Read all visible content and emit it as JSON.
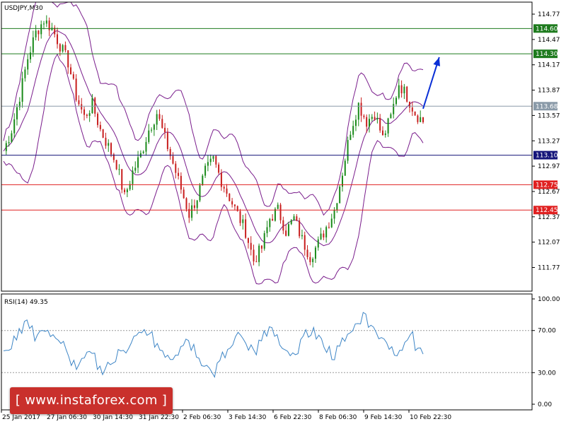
{
  "chart_data": {
    "type": "line",
    "symbol_label": "USDJPY,M30",
    "price_panel": {
      "y_ticks": [
        "114.77",
        "114.47",
        "114.17",
        "113.87",
        "113.57",
        "113.27",
        "112.97",
        "112.67",
        "112.37",
        "112.07",
        "111.77"
      ],
      "ylim": [
        111.6,
        114.93
      ],
      "levels": [
        {
          "value": 114.6,
          "label": "114.60",
          "color": "#1e7b1e"
        },
        {
          "value": 114.3,
          "label": "114.30",
          "color": "#1e7b1e"
        },
        {
          "value": 113.68,
          "label": "113.68",
          "color": "#8a9aa8"
        },
        {
          "value": 113.1,
          "label": "113.10",
          "color": "#15157a"
        },
        {
          "value": 112.75,
          "label": "112.75",
          "color": "#e02020"
        },
        {
          "value": 112.45,
          "label": "112.45",
          "color": "#e02020"
        }
      ],
      "close_path": [
        [
          0,
          113.15
        ],
        [
          3,
          113.4
        ],
        [
          6,
          113.8
        ],
        [
          9,
          114.25
        ],
        [
          12,
          114.55
        ],
        [
          15,
          114.7
        ],
        [
          18,
          114.6
        ],
        [
          21,
          114.4
        ],
        [
          24,
          114.2
        ],
        [
          27,
          113.8
        ],
        [
          30,
          113.55
        ],
        [
          33,
          113.7
        ],
        [
          36,
          113.4
        ],
        [
          39,
          113.2
        ],
        [
          42,
          113.0
        ],
        [
          45,
          112.6
        ],
        [
          48,
          112.9
        ],
        [
          51,
          113.1
        ],
        [
          54,
          113.4
        ],
        [
          57,
          113.6
        ],
        [
          60,
          113.3
        ],
        [
          63,
          113.0
        ],
        [
          66,
          112.7
        ],
        [
          69,
          112.4
        ],
        [
          72,
          112.6
        ],
        [
          75,
          112.9
        ],
        [
          78,
          113.05
        ],
        [
          81,
          112.8
        ],
        [
          84,
          112.6
        ],
        [
          87,
          112.4
        ],
        [
          90,
          112.2
        ],
        [
          93,
          111.85
        ],
        [
          96,
          112.0
        ],
        [
          99,
          112.35
        ],
        [
          102,
          112.45
        ],
        [
          105,
          112.2
        ],
        [
          108,
          112.35
        ],
        [
          111,
          112.1
        ],
        [
          114,
          111.9
        ],
        [
          117,
          112.05
        ],
        [
          120,
          112.25
        ],
        [
          123,
          112.45
        ],
        [
          126,
          112.9
        ],
        [
          129,
          113.4
        ],
        [
          132,
          113.7
        ],
        [
          135,
          113.5
        ],
        [
          138,
          113.6
        ],
        [
          141,
          113.3
        ],
        [
          144,
          113.55
        ],
        [
          147,
          113.95
        ],
        [
          150,
          113.8
        ],
        [
          153,
          113.6
        ],
        [
          156,
          113.5
        ]
      ],
      "arrow": {
        "from": [
          156,
          113.65
        ],
        "to": [
          162,
          114.26
        ]
      },
      "bands_description_free": true
    },
    "rsi_panel": {
      "label": "RSI(14) 49.35",
      "y_ticks": [
        "100.00",
        "70.00",
        "30.00",
        "0.00"
      ],
      "ylim": [
        0,
        100
      ],
      "levels": [
        70,
        30
      ],
      "values": [
        50,
        55,
        65,
        72,
        78,
        70,
        62,
        68,
        74,
        66,
        60,
        55,
        48,
        40,
        35,
        45,
        52,
        44,
        38,
        30,
        35,
        42,
        50,
        48,
        55,
        62,
        66,
        70,
        64,
        58,
        52,
        48,
        45,
        50,
        58,
        62,
        55,
        48,
        40,
        36,
        30,
        38,
        45,
        52,
        60,
        68,
        62,
        55,
        50,
        58,
        66,
        72,
        62,
        54,
        48,
        44,
        52,
        60,
        66,
        70,
        64,
        58,
        52,
        46,
        52,
        60,
        66,
        74,
        80,
        84,
        78,
        72,
        64,
        58,
        52,
        48,
        55,
        62,
        68,
        56,
        49
      ],
      "color": "#3d85c6"
    },
    "x_ticks": [
      "25 Jan 2017",
      "27 Jan 06:30",
      "30 Jan 14:30",
      "31 Jan 22:30",
      "2 Feb 06:30",
      "3 Feb 14:30",
      "6 Feb 22:30",
      "8 Feb 06:30",
      "9 Feb 14:30",
      "10 Feb 22:30"
    ],
    "candle_colors": {
      "up": "#1a8a1a",
      "down": "#c81e1e"
    },
    "band_color": "#7a1d8c"
  },
  "watermark": {
    "text": "[ www.instaforex.com ]"
  }
}
